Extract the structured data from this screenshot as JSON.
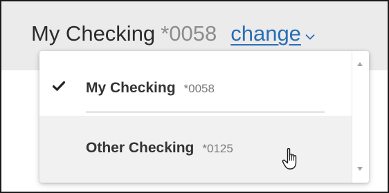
{
  "header": {
    "account_name": "My Checking",
    "account_number": "*0058",
    "change_label": "change"
  },
  "dropdown": {
    "options": [
      {
        "name": "My Checking",
        "number": "*0058",
        "selected": true
      },
      {
        "name": "Other Checking",
        "number": "*0125",
        "selected": false,
        "hovered": true
      }
    ]
  },
  "icons": {
    "chevron": "chevron-down-icon",
    "check": "checkmark-icon",
    "cursor": "hand-pointer-icon",
    "scroll_up": "scroll-up-arrow-icon",
    "scroll_down": "scroll-down-arrow-icon"
  },
  "colors": {
    "link": "#2a6db5",
    "header_band": "#ebebeb",
    "hover_row": "#f1f1f1",
    "text_dark": "#333333",
    "text_muted": "#7a7a7a"
  }
}
